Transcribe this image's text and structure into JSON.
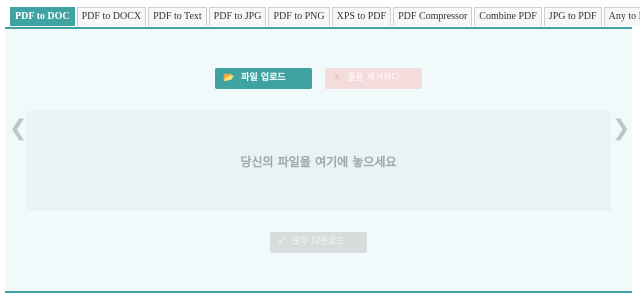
{
  "tabs": [
    {
      "label": "PDF to DOC",
      "active": true
    },
    {
      "label": "PDF to DOCX"
    },
    {
      "label": "PDF to Text"
    },
    {
      "label": "PDF to JPG"
    },
    {
      "label": "PDF to PNG"
    },
    {
      "label": "XPS to PDF"
    },
    {
      "label": "PDF Compressor"
    },
    {
      "label": "Combine PDF"
    },
    {
      "label": "JPG to PDF"
    },
    {
      "label": "Any to PDF"
    }
  ],
  "buttons": {
    "upload_label": "파일 업로드",
    "upload_icon": "folder-open-icon",
    "clear_label": "줄을 제거하다",
    "clear_icon": "close-icon",
    "download_all_label": "모두 다운로드",
    "download_all_icon": "check-icon"
  },
  "dropzone": {
    "text": "당신의 파일을 여기에 놓으세요"
  },
  "nav": {
    "prev_glyph": "❮",
    "next_glyph": "❯"
  },
  "colors": {
    "accent": "#3fa3a3",
    "panel_bg": "#f1fafa",
    "clear_bg": "#f4dcdc"
  }
}
